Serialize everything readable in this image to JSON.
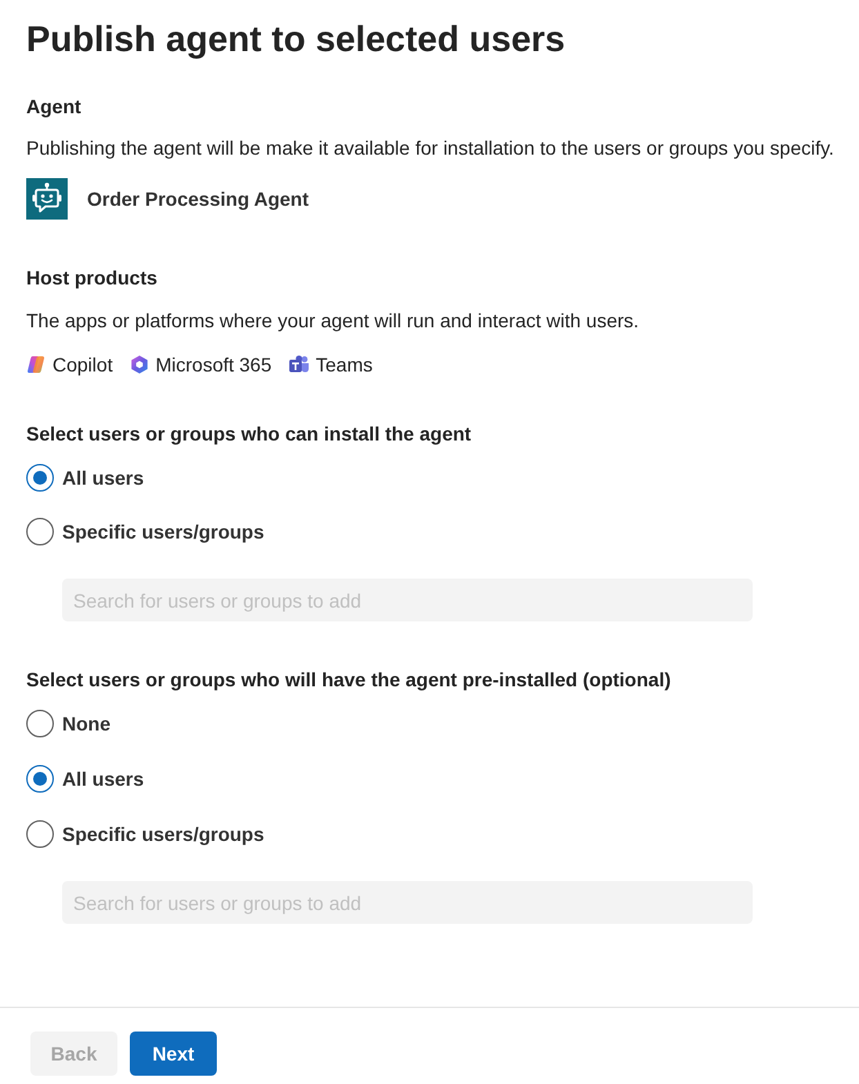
{
  "title": "Publish agent to selected users",
  "agent": {
    "heading": "Agent",
    "description": "Publishing the agent will be make it available for installation to the users or groups you specify.",
    "name": "Order Processing Agent"
  },
  "host_products": {
    "heading": "Host products",
    "description": "The apps or platforms where your agent will run and interact with users.",
    "products": [
      {
        "kind": "swirl",
        "name": "Copilot"
      },
      {
        "kind": "ring",
        "name": "Microsoft 365"
      },
      {
        "kind": "tile",
        "name": "Teams"
      }
    ]
  },
  "install_access": {
    "heading": "Select users or groups who can install the agent",
    "options": [
      {
        "label": "All users",
        "selected": true
      },
      {
        "label": "Specific users/groups",
        "selected": false
      }
    ],
    "search": {
      "placeholder": "Search for users or groups to add",
      "disabled": true
    }
  },
  "preinstall": {
    "heading": "Select users or groups who will have the agent pre-installed (optional)",
    "options": [
      {
        "label": "None",
        "selected": false
      },
      {
        "label": "All users",
        "selected": true
      },
      {
        "label": "Specific users/groups",
        "selected": false
      }
    ],
    "search": {
      "placeholder": "Search for users or groups to add",
      "disabled": true
    }
  },
  "buttons": [
    {
      "label": "Back",
      "kind": "secondary",
      "disabled": true
    },
    {
      "label": "Next",
      "kind": "primary",
      "disabled": false
    }
  ]
}
